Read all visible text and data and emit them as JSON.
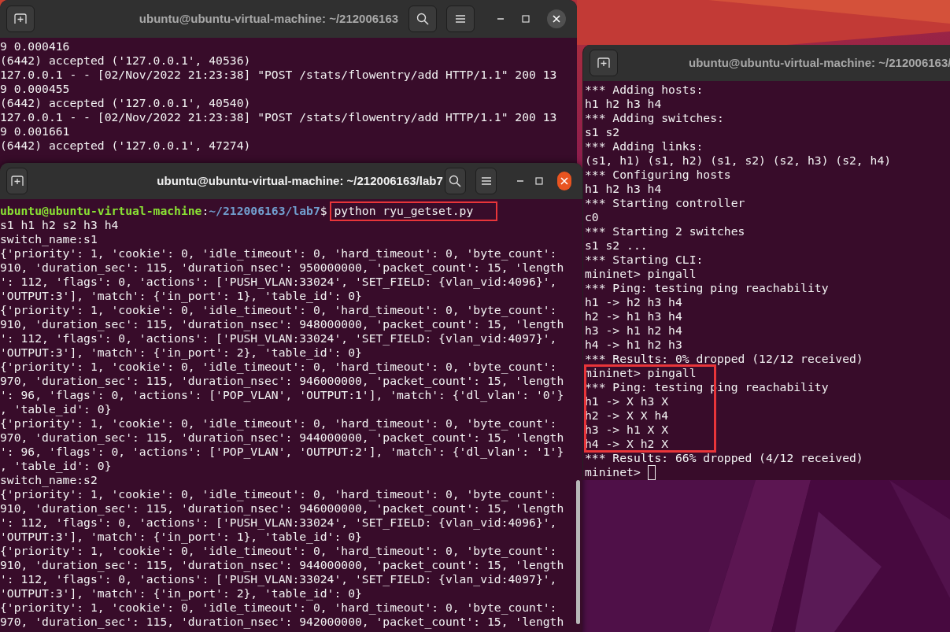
{
  "windows": [
    {
      "title": "ubuntu@ubuntu-virtual-machine: ~/212006163",
      "active": false,
      "controls": [
        {
          "kind": "new_tab"
        },
        {
          "kind": "search"
        },
        {
          "kind": "menu"
        },
        {
          "kind": "minimize"
        },
        {
          "kind": "maximize"
        },
        {
          "kind": "close"
        }
      ],
      "lines": [
        {
          "kind": "text",
          "text": "9 0.000416"
        },
        {
          "kind": "text",
          "text": "(6442) accepted ('127.0.0.1', 40536)"
        },
        {
          "kind": "text",
          "text": "127.0.0.1 - - [02/Nov/2022 21:23:38] \"POST /stats/flowentry/add HTTP/1.1\" 200 13"
        },
        {
          "kind": "text",
          "text": "9 0.000455"
        },
        {
          "kind": "text",
          "text": "(6442) accepted ('127.0.0.1', 40540)"
        },
        {
          "kind": "text",
          "text": "127.0.0.1 - - [02/Nov/2022 21:23:38] \"POST /stats/flowentry/add HTTP/1.1\" 200 13"
        },
        {
          "kind": "text",
          "text": "9 0.001661"
        },
        {
          "kind": "text",
          "text": "(6442) accepted ('127.0.0.1', 47274)"
        }
      ]
    },
    {
      "title": "ubuntu@ubuntu-virtual-machine: ~/212006163/lab7",
      "active": true,
      "scrollbar": true,
      "controls": [
        {
          "kind": "new_tab"
        },
        {
          "kind": "search"
        },
        {
          "kind": "menu"
        },
        {
          "kind": "minimize"
        },
        {
          "kind": "maximize"
        },
        {
          "kind": "close"
        }
      ],
      "lines": [
        {
          "kind": "prompt",
          "user": "ubuntu@ubuntu-virtual-machine",
          "separator": ":",
          "path": "~/212006163/lab7",
          "symbol": "$",
          "command": "python ryu_getset.py",
          "highlighted": true
        },
        {
          "kind": "text",
          "text": "s1 h1 h2 s2 h3 h4"
        },
        {
          "kind": "text",
          "text": "switch_name:s1"
        },
        {
          "kind": "text",
          "text": "{'priority': 1, 'cookie': 0, 'idle_timeout': 0, 'hard_timeout': 0, 'byte_count':"
        },
        {
          "kind": "text",
          "text": "910, 'duration_sec': 115, 'duration_nsec': 950000000, 'packet_count': 15, 'length"
        },
        {
          "kind": "text",
          "text": "': 112, 'flags': 0, 'actions': ['PUSH_VLAN:33024', 'SET_FIELD: {vlan_vid:4096}',"
        },
        {
          "kind": "text",
          "text": "'OUTPUT:3'], 'match': {'in_port': 1}, 'table_id': 0}"
        },
        {
          "kind": "text",
          "text": "{'priority': 1, 'cookie': 0, 'idle_timeout': 0, 'hard_timeout': 0, 'byte_count':"
        },
        {
          "kind": "text",
          "text": "910, 'duration_sec': 115, 'duration_nsec': 948000000, 'packet_count': 15, 'length"
        },
        {
          "kind": "text",
          "text": "': 112, 'flags': 0, 'actions': ['PUSH_VLAN:33024', 'SET_FIELD: {vlan_vid:4097}',"
        },
        {
          "kind": "text",
          "text": "'OUTPUT:3'], 'match': {'in_port': 2}, 'table_id': 0}"
        },
        {
          "kind": "text",
          "text": "{'priority': 1, 'cookie': 0, 'idle_timeout': 0, 'hard_timeout': 0, 'byte_count':"
        },
        {
          "kind": "text",
          "text": "970, 'duration_sec': 115, 'duration_nsec': 946000000, 'packet_count': 15, 'length"
        },
        {
          "kind": "text",
          "text": "': 96, 'flags': 0, 'actions': ['POP_VLAN', 'OUTPUT:1'], 'match': {'dl_vlan': '0'}"
        },
        {
          "kind": "text",
          "text": ", 'table_id': 0}"
        },
        {
          "kind": "text",
          "text": "{'priority': 1, 'cookie': 0, 'idle_timeout': 0, 'hard_timeout': 0, 'byte_count':"
        },
        {
          "kind": "text",
          "text": "970, 'duration_sec': 115, 'duration_nsec': 944000000, 'packet_count': 15, 'length"
        },
        {
          "kind": "text",
          "text": "': 96, 'flags': 0, 'actions': ['POP_VLAN', 'OUTPUT:2'], 'match': {'dl_vlan': '1'}"
        },
        {
          "kind": "text",
          "text": ", 'table_id': 0}"
        },
        {
          "kind": "text",
          "text": "switch_name:s2"
        },
        {
          "kind": "text",
          "text": "{'priority': 1, 'cookie': 0, 'idle_timeout': 0, 'hard_timeout': 0, 'byte_count':"
        },
        {
          "kind": "text",
          "text": "910, 'duration_sec': 115, 'duration_nsec': 946000000, 'packet_count': 15, 'length"
        },
        {
          "kind": "text",
          "text": "': 112, 'flags': 0, 'actions': ['PUSH_VLAN:33024', 'SET_FIELD: {vlan_vid:4096}',"
        },
        {
          "kind": "text",
          "text": "'OUTPUT:3'], 'match': {'in_port': 1}, 'table_id': 0}"
        },
        {
          "kind": "text",
          "text": "{'priority': 1, 'cookie': 0, 'idle_timeout': 0, 'hard_timeout': 0, 'byte_count':"
        },
        {
          "kind": "text",
          "text": "910, 'duration_sec': 115, 'duration_nsec': 944000000, 'packet_count': 15, 'length"
        },
        {
          "kind": "text",
          "text": "': 112, 'flags': 0, 'actions': ['PUSH_VLAN:33024', 'SET_FIELD: {vlan_vid:4097}',"
        },
        {
          "kind": "text",
          "text": "'OUTPUT:3'], 'match': {'in_port': 2}, 'table_id': 0}"
        },
        {
          "kind": "text",
          "text": "{'priority': 1, 'cookie': 0, 'idle_timeout': 0, 'hard_timeout': 0, 'byte_count':"
        },
        {
          "kind": "text",
          "text": "970, 'duration_sec': 115, 'duration_nsec': 942000000, 'packet_count': 15, 'length"
        }
      ]
    },
    {
      "title": "ubuntu@ubuntu-virtual-machine: ~/212006163/",
      "active": false,
      "controls": [
        {
          "kind": "new_tab"
        }
      ],
      "lines": [
        {
          "kind": "text",
          "text": "*** Adding hosts:"
        },
        {
          "kind": "text",
          "text": "h1 h2 h3 h4"
        },
        {
          "kind": "text",
          "text": "*** Adding switches:"
        },
        {
          "kind": "text",
          "text": "s1 s2"
        },
        {
          "kind": "text",
          "text": "*** Adding links:"
        },
        {
          "kind": "text",
          "text": "(s1, h1) (s1, h2) (s1, s2) (s2, h3) (s2, h4)"
        },
        {
          "kind": "text",
          "text": "*** Configuring hosts"
        },
        {
          "kind": "text",
          "text": "h1 h2 h3 h4"
        },
        {
          "kind": "text",
          "text": "*** Starting controller"
        },
        {
          "kind": "text",
          "text": "c0"
        },
        {
          "kind": "text",
          "text": "*** Starting 2 switches"
        },
        {
          "kind": "text",
          "text": "s1 s2 ..."
        },
        {
          "kind": "text",
          "text": "*** Starting CLI:"
        },
        {
          "kind": "text",
          "text": "mininet> pingall"
        },
        {
          "kind": "text",
          "text": "*** Ping: testing ping reachability"
        },
        {
          "kind": "text",
          "text": "h1 -> h2 h3 h4"
        },
        {
          "kind": "text",
          "text": "h2 -> h1 h3 h4"
        },
        {
          "kind": "text",
          "text": "h3 -> h1 h2 h4"
        },
        {
          "kind": "text",
          "text": "h4 -> h1 h2 h3"
        },
        {
          "kind": "text",
          "text": "*** Results: 0% dropped (12/12 received)"
        },
        {
          "kind": "boxed",
          "lines": [
            "mininet> pingall",
            "*** Ping: testing ping reachability",
            "h1 -> X h3 X",
            "h2 -> X X h4",
            "h3 -> h1 X X",
            "h4 -> X h2 X"
          ]
        },
        {
          "kind": "text",
          "text": "*** Results: 66% dropped (4/12 received)"
        },
        {
          "kind": "input",
          "text": "mininet>",
          "cursor": true
        }
      ]
    }
  ]
}
